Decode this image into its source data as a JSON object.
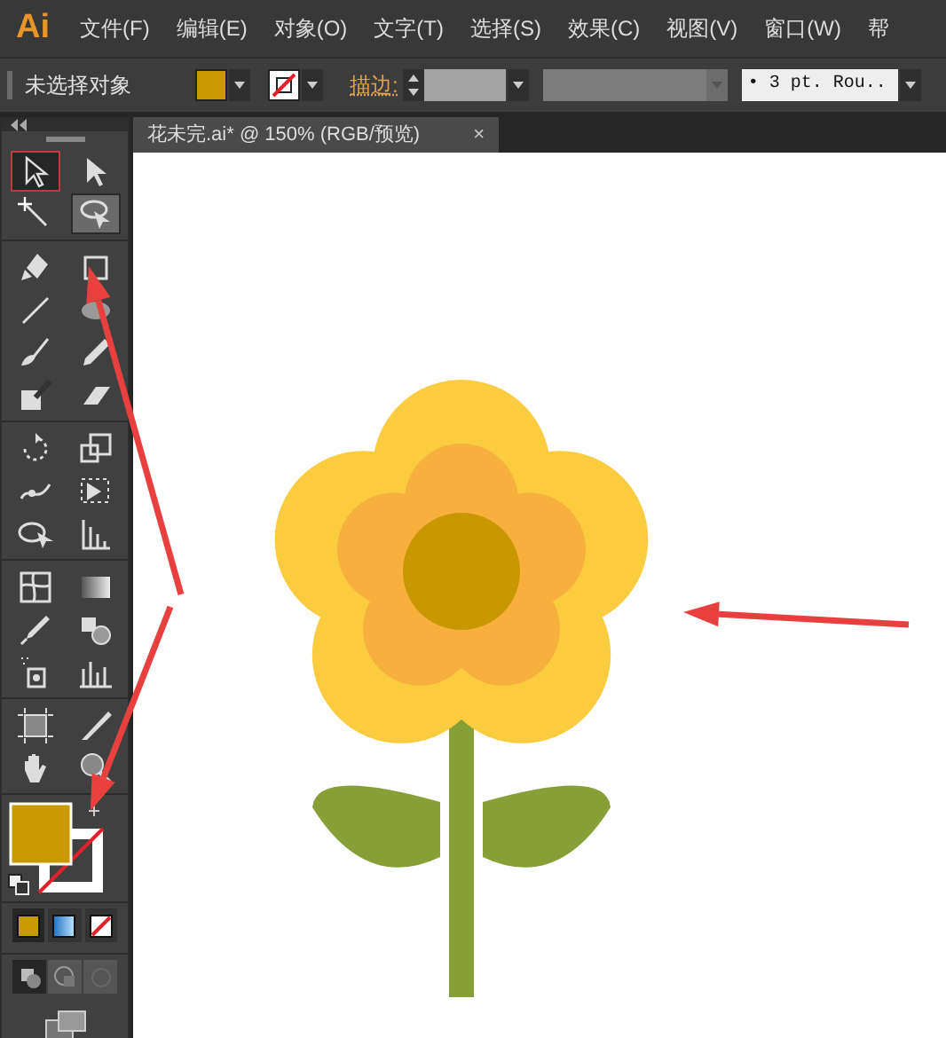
{
  "app": {
    "logo": "Ai"
  },
  "menu": [
    {
      "label": "文件(F)"
    },
    {
      "label": "编辑(E)"
    },
    {
      "label": "对象(O)"
    },
    {
      "label": "文字(T)"
    },
    {
      "label": "选择(S)"
    },
    {
      "label": "效果(C)"
    },
    {
      "label": "视图(V)"
    },
    {
      "label": "窗口(W)"
    },
    {
      "label": "帮"
    }
  ],
  "control_bar": {
    "selection_status": "未选择对象",
    "stroke_label": "描边:",
    "brush": "• 3 pt. Rou.."
  },
  "document_tab": {
    "title": "花未完.ai* @ 150% (RGB/预览)",
    "close": "×"
  },
  "tools": [
    {
      "selected": true
    },
    {
      "selected": false
    },
    {
      "selected": false
    },
    {
      "selected": true
    },
    {
      "selected": false
    },
    {
      "selected": false
    },
    {
      "selected": false
    },
    {
      "selected": false
    },
    {
      "selected": false
    },
    {
      "selected": false
    },
    {
      "selected": false
    },
    {
      "selected": false
    },
    {
      "selected": false
    },
    {
      "selected": false
    },
    {
      "selected": false
    },
    {
      "selected": false
    },
    {
      "selected": false
    },
    {
      "selected": false
    },
    {
      "selected": false
    },
    {
      "selected": false
    },
    {
      "selected": false
    },
    {
      "selected": false
    },
    {
      "selected": false
    },
    {
      "selected": false
    },
    {
      "selected": false
    },
    {
      "selected": false
    },
    {
      "selected": false
    },
    {
      "selected": false
    }
  ],
  "color_modes": [
    {
      "selected": true
    },
    {
      "selected": false
    },
    {
      "selected": false
    }
  ],
  "draw_modes": [
    {
      "selected": true
    },
    {
      "selected": false
    },
    {
      "selected": false
    }
  ]
}
